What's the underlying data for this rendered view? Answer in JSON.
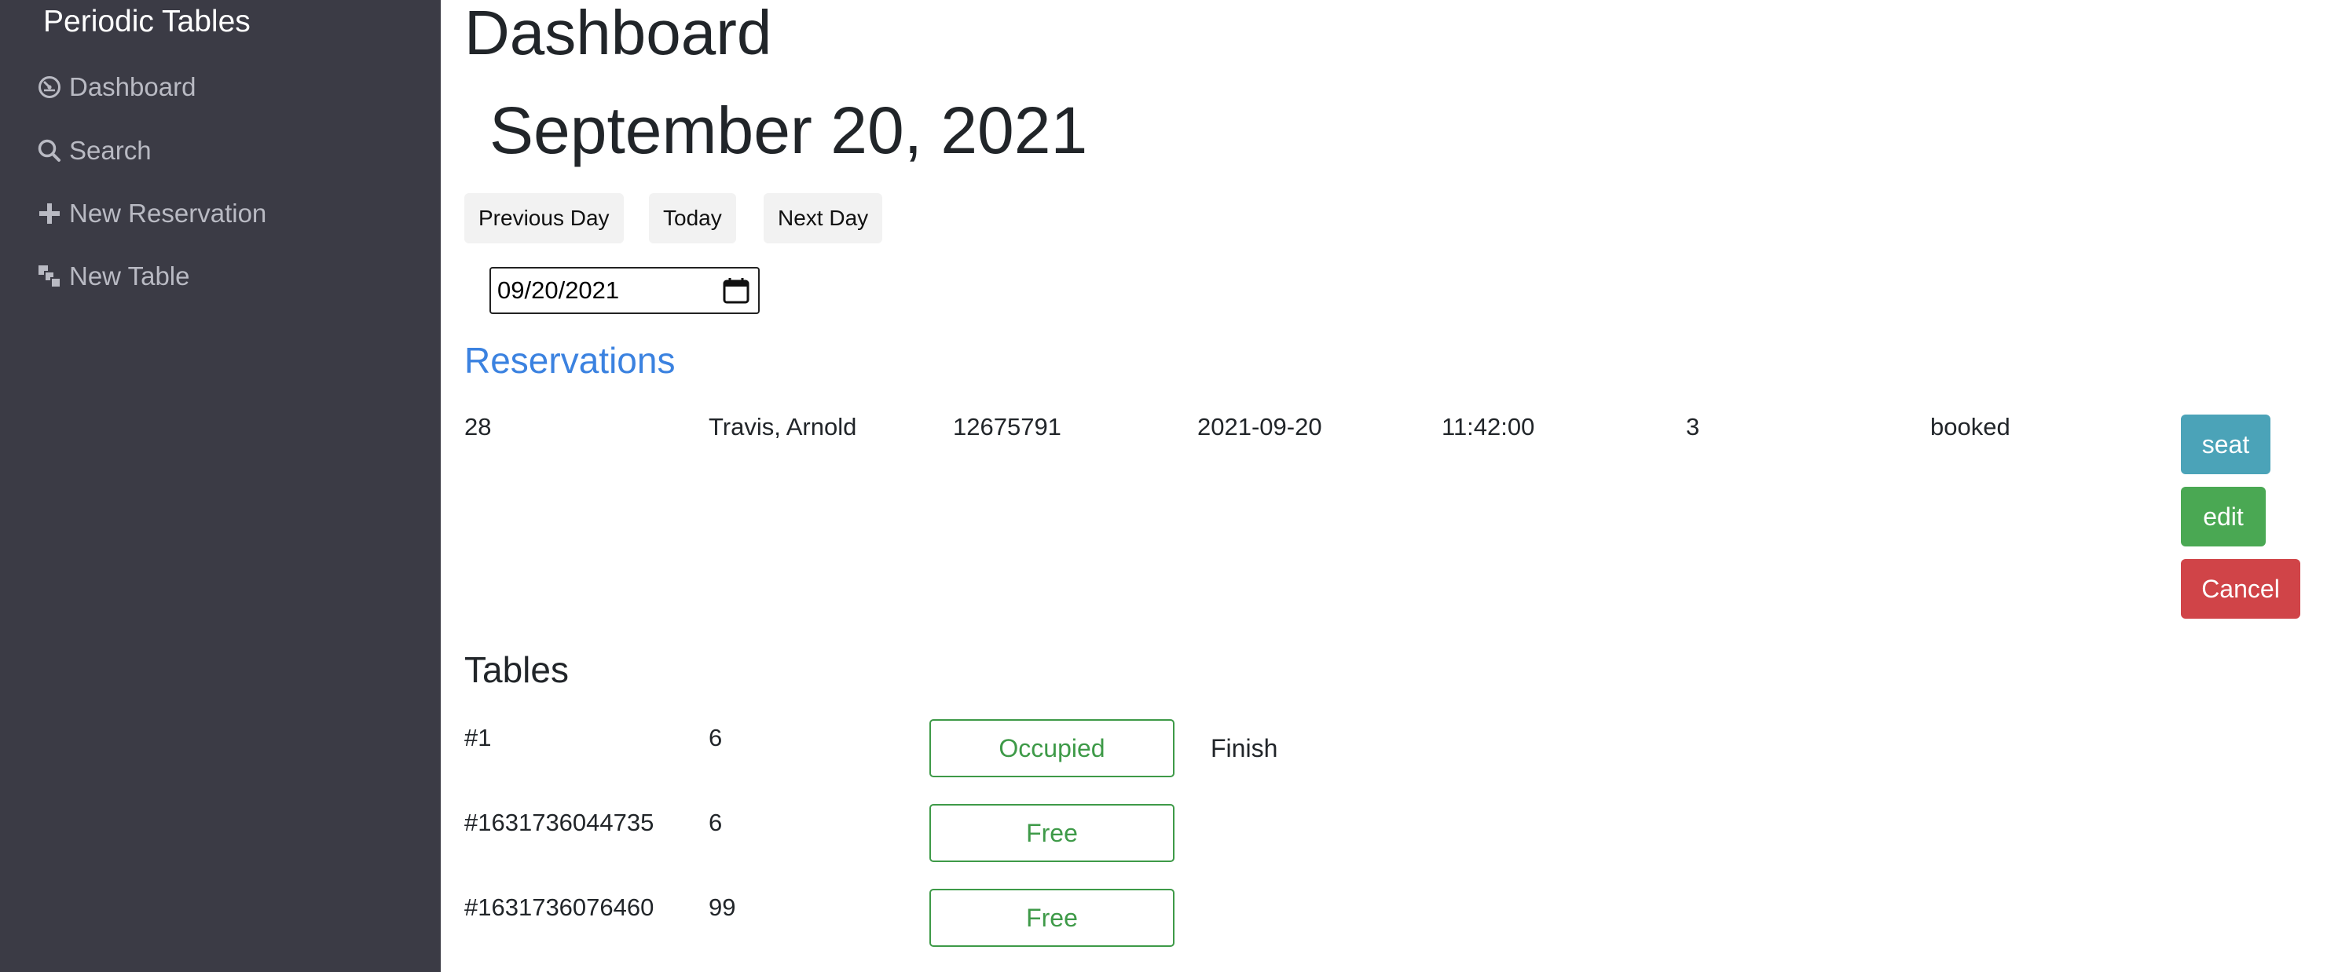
{
  "sidebar": {
    "brand": "Periodic Tables",
    "items": [
      {
        "label": "Dashboard",
        "icon": "dashboard-icon"
      },
      {
        "label": "Search",
        "icon": "search-icon"
      },
      {
        "label": "New Reservation",
        "icon": "plus-icon"
      },
      {
        "label": "New Table",
        "icon": "layers-icon"
      }
    ]
  },
  "main": {
    "title": "Dashboard",
    "date_heading": "September 20, 2021",
    "nav_buttons": {
      "previous": "Previous Day",
      "today": "Today",
      "next": "Next Day"
    },
    "date_input": {
      "value": "09/20/2021"
    }
  },
  "reservations": {
    "heading": "Reservations",
    "rows": [
      {
        "id": "28",
        "name": "Travis, Arnold",
        "mobile": "12675791",
        "date": "2021-09-20",
        "time": "11:42:00",
        "people": "3",
        "status": "booked",
        "actions": {
          "seat": "seat",
          "edit": "edit",
          "cancel": "Cancel"
        }
      }
    ]
  },
  "tables": {
    "heading": "Tables",
    "rows": [
      {
        "name": "#1",
        "capacity": "6",
        "status": "Occupied",
        "finish": "Finish"
      },
      {
        "name": "#1631736044735",
        "capacity": "6",
        "status": "Free"
      },
      {
        "name": "#1631736076460",
        "capacity": "99",
        "status": "Free"
      }
    ]
  },
  "colors": {
    "sidebar_bg": "#3b3b45",
    "accent_blue": "#3b82e0",
    "seat": "#4ba3b8",
    "edit": "#4aa853",
    "cancel": "#d04448",
    "status_green": "#3e9a48"
  }
}
